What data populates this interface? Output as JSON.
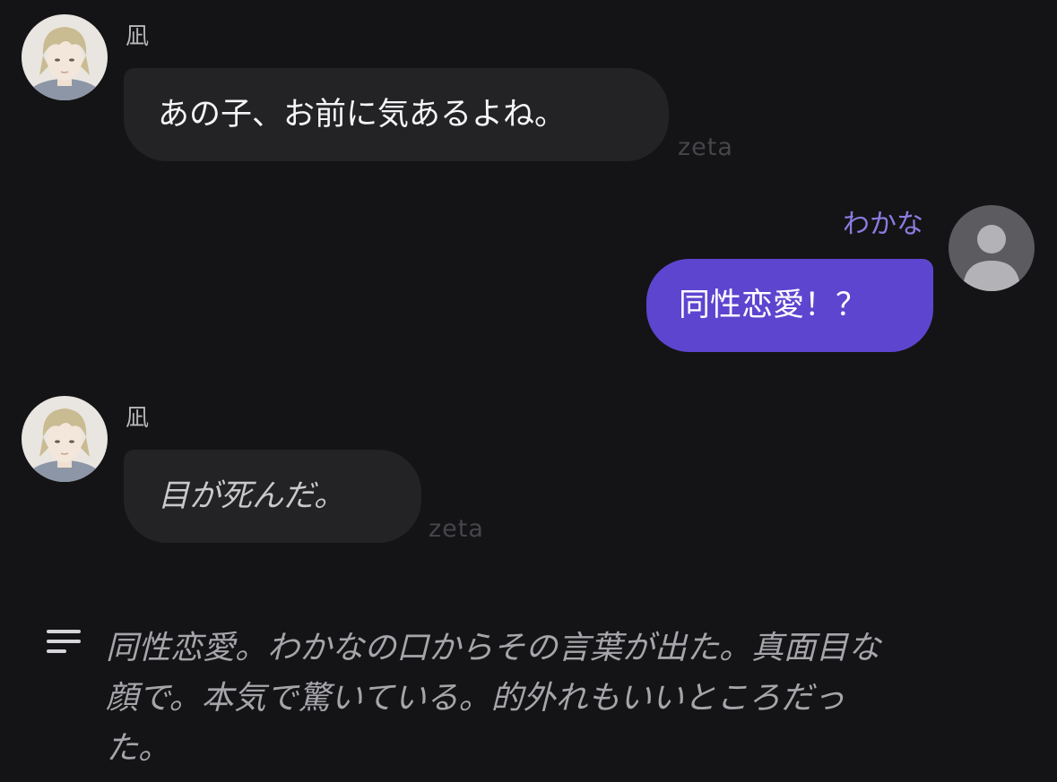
{
  "messages": [
    {
      "sender": "凪",
      "text": "あの子、お前に気あるよね。",
      "watermark": "zeta"
    },
    {
      "sender": "わかな",
      "text": "同性恋愛！？"
    },
    {
      "sender": "凪",
      "text": "目が死んだ。",
      "watermark": "zeta"
    }
  ],
  "narration": {
    "icon": "menu-lines-icon",
    "text": "同性恋愛。わかなの口からその言葉が出た。真面目な\n顔で。本気で驚いている。的外れもいいところだっ\nた。"
  },
  "colors": {
    "background": "#141416",
    "character_bubble": "#232326",
    "user_bubble": "#5e45cf",
    "user_name": "#8a7ce0"
  }
}
